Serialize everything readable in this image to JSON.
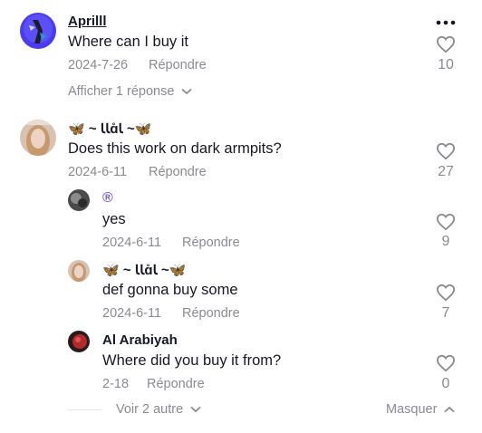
{
  "comments": [
    {
      "author": "Aprilll",
      "text": "Where can I buy it",
      "date": "2024-7-26",
      "reply_label": "Répondre",
      "likes": "10",
      "show_replies": "Afficher 1 réponse"
    },
    {
      "author": "🦋 ~ ꙆꙆɑ̊Ꙇ ~🦋",
      "text": "Does this work on dark armpits?",
      "date": "2024-6-11",
      "reply_label": "Répondre",
      "likes": "27",
      "replies": [
        {
          "author": "®",
          "text": "yes",
          "date": "2024-6-11",
          "reply_label": "Répondre",
          "likes": "9"
        },
        {
          "author": "🦋 ~ ꙆꙆɑ̊Ꙇ ~🦋",
          "text": "def gonna buy some",
          "date": "2024-6-11",
          "reply_label": "Répondre",
          "likes": "7"
        },
        {
          "author": "Al Arabiyah",
          "text": "Where did you buy it from?",
          "date": "2-18",
          "reply_label": "Répondre",
          "likes": "0"
        }
      ],
      "more_label": "Voir 2 autre",
      "hide_label": "Masquer"
    }
  ],
  "colors": {
    "text": "#161823",
    "secondary": "#8a8b91",
    "accent_purple": "#7b5cd6"
  }
}
